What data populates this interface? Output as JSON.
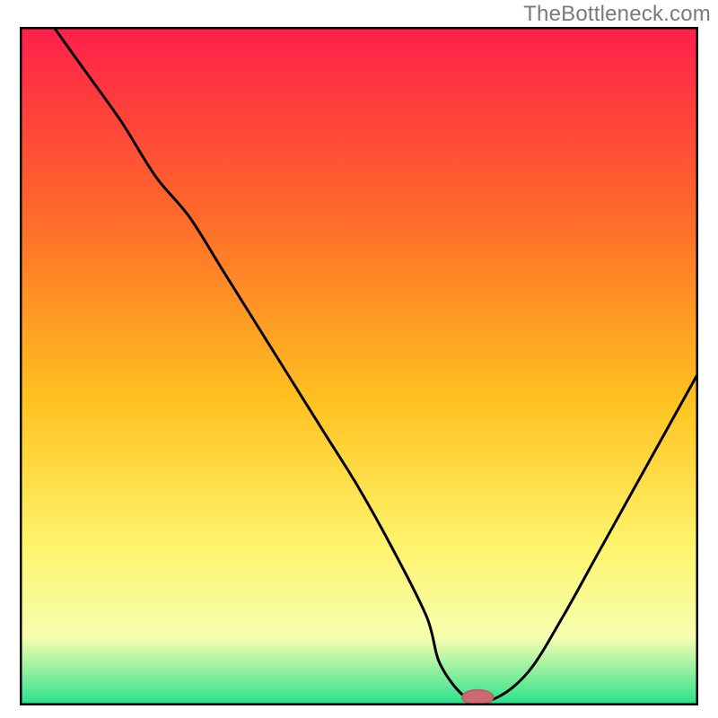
{
  "attribution": "TheBottleneck.com",
  "colors": {
    "gradient_top": "#ff1f4b",
    "gradient_mid1": "#ff6a2a",
    "gradient_mid2": "#ffc21f",
    "gradient_mid3": "#fff36a",
    "gradient_mid4": "#f6ffb0",
    "gradient_bottom": "#28e08b",
    "border": "#000000",
    "curve": "#000000",
    "marker_fill": "#cc6b6f",
    "marker_stroke": "#b85a5e"
  },
  "chart_data": {
    "type": "line",
    "title": "",
    "xlabel": "",
    "ylabel": "",
    "xlim": [
      0,
      100
    ],
    "ylim": [
      0,
      100
    ],
    "series": [
      {
        "name": "bottleneck-curve",
        "x": [
          5,
          10,
          15,
          20,
          25,
          30,
          35,
          40,
          45,
          50,
          55,
          60,
          62,
          66,
          70,
          75,
          80,
          85,
          90,
          95,
          100
        ],
        "values": [
          100,
          93,
          86,
          78,
          72,
          64,
          56,
          48,
          40,
          32,
          23,
          13,
          6,
          1,
          1,
          5,
          13,
          22,
          31,
          40,
          49
        ]
      }
    ],
    "marker": {
      "x": 67.5,
      "y": 1.2,
      "rx": 2.3,
      "ry": 1.1
    },
    "baseline_y": 0.3
  }
}
